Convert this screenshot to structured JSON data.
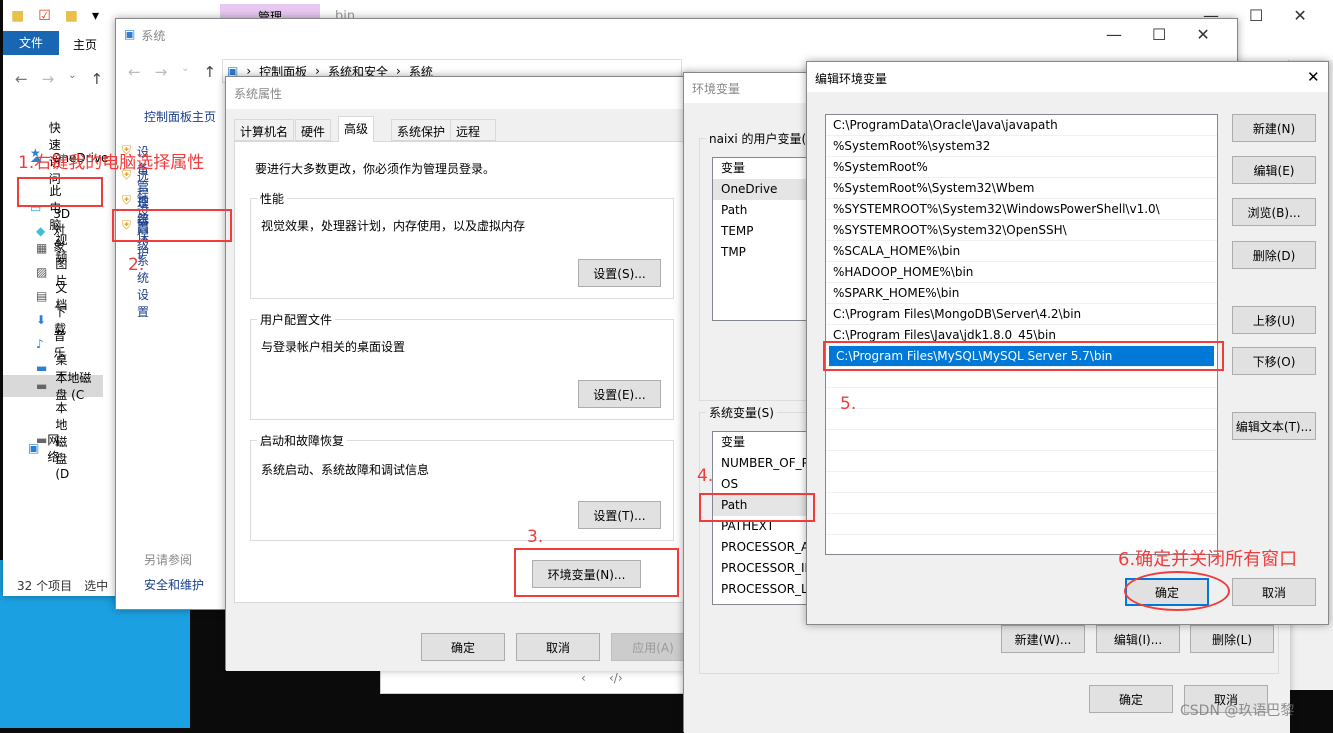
{
  "explorer": {
    "tab_manage": "管理",
    "title": "bin",
    "ribbon_file": "文件",
    "ribbon_home": "主页",
    "nav": [
      {
        "label": "快速访问",
        "icon": "star-icon"
      },
      {
        "label": "OneDrive",
        "icon": "cloud-icon"
      },
      {
        "label": "此电脑",
        "icon": "computer-icon"
      },
      {
        "label": "3D 对象",
        "icon": "cube-icon"
      },
      {
        "label": "视频",
        "icon": "video-icon"
      },
      {
        "label": "图片",
        "icon": "picture-icon"
      },
      {
        "label": "文档",
        "icon": "document-icon"
      },
      {
        "label": "下载",
        "icon": "download-icon"
      },
      {
        "label": "音乐",
        "icon": "music-icon"
      },
      {
        "label": "桌面",
        "icon": "desktop-icon"
      },
      {
        "label": "本地磁盘 (C",
        "icon": "drive-icon"
      },
      {
        "label": "本地磁盘 (D",
        "icon": "drive-icon"
      },
      {
        "label": "网络",
        "icon": "network-icon"
      }
    ],
    "status_count": "32 个项目",
    "status_selected": "选中"
  },
  "system": {
    "title": "系统",
    "breadcrumb": [
      "控制面板",
      "系统和安全",
      "系统"
    ],
    "home": "控制面板主页",
    "links": [
      "设备管理器",
      "远程设置",
      "系统保护",
      "高级系统设置"
    ],
    "see_also": "另请参阅",
    "security": "安全和维护"
  },
  "sysprops": {
    "title": "系统属性",
    "tabs": [
      "计算机名",
      "硬件",
      "高级",
      "系统保护",
      "远程"
    ],
    "admin_note": "要进行大多数更改，你必须作为管理员登录。",
    "perf": {
      "legend": "性能",
      "desc": "视觉效果，处理器计划，内存使用，以及虚拟内存",
      "button": "设置(S)..."
    },
    "profile": {
      "legend": "用户配置文件",
      "desc": "与登录帐户相关的桌面设置",
      "button": "设置(E)..."
    },
    "startup": {
      "legend": "启动和故障恢复",
      "desc": "系统启动、系统故障和调试信息",
      "button": "设置(T)..."
    },
    "env_button": "环境变量(N)...",
    "ok": "确定",
    "cancel": "取消",
    "apply": "应用(A)"
  },
  "envvars": {
    "title": "环境变量",
    "user_legend": "naixi 的用户变量(U",
    "user_header": "变量",
    "user_vars": [
      "OneDrive",
      "Path",
      "TEMP",
      "TMP"
    ],
    "sys_legend": "系统变量(S)",
    "sys_header": "变量",
    "sys_vars": [
      "NUMBER_OF_PI",
      "OS",
      "Path",
      "PATHEXT",
      "PROCESSOR_AR",
      "PROCESSOR_ID",
      "PROCESSOR_LE"
    ],
    "new": "新建(W)...",
    "edit": "编辑(I)...",
    "delete": "删除(L)",
    "ok": "确定",
    "cancel": "取消"
  },
  "editenv": {
    "title": "编辑环境变量",
    "paths": [
      "C:\\ProgramData\\Oracle\\Java\\javapath",
      "%SystemRoot%\\system32",
      "%SystemRoot%",
      "%SystemRoot%\\System32\\Wbem",
      "%SYSTEMROOT%\\System32\\WindowsPowerShell\\v1.0\\",
      "%SYSTEMROOT%\\System32\\OpenSSH\\",
      "%SCALA_HOME%\\bin",
      "%HADOOP_HOME%\\bin",
      "%SPARK_HOME%\\bin",
      "C:\\Program Files\\MongoDB\\Server\\4.2\\bin",
      "C:\\Program Files\\Java\\jdk1.8.0_45\\bin",
      "C:\\Program Files\\MySQL\\MySQL Server 5.7\\bin"
    ],
    "selected_index": 11,
    "buttons": [
      "新建(N)",
      "编辑(E)",
      "浏览(B)...",
      "删除(D)",
      "上移(U)",
      "下移(O)",
      "编辑文本(T)..."
    ],
    "ok": "确定",
    "cancel": "取消"
  },
  "annotations": {
    "step1": "1.右键我的电脑选择属性",
    "step2": "2.",
    "step3": "3.",
    "step4": "4.",
    "step5": "5.",
    "step6": "6.确定并关闭所有窗口"
  },
  "watermark": "CSDN @玖语巴黎",
  "colors": {
    "accent": "#0078d7",
    "annotation": "#f03c3c",
    "selection": "#0078d7",
    "desktop": "#1ba1e2"
  }
}
